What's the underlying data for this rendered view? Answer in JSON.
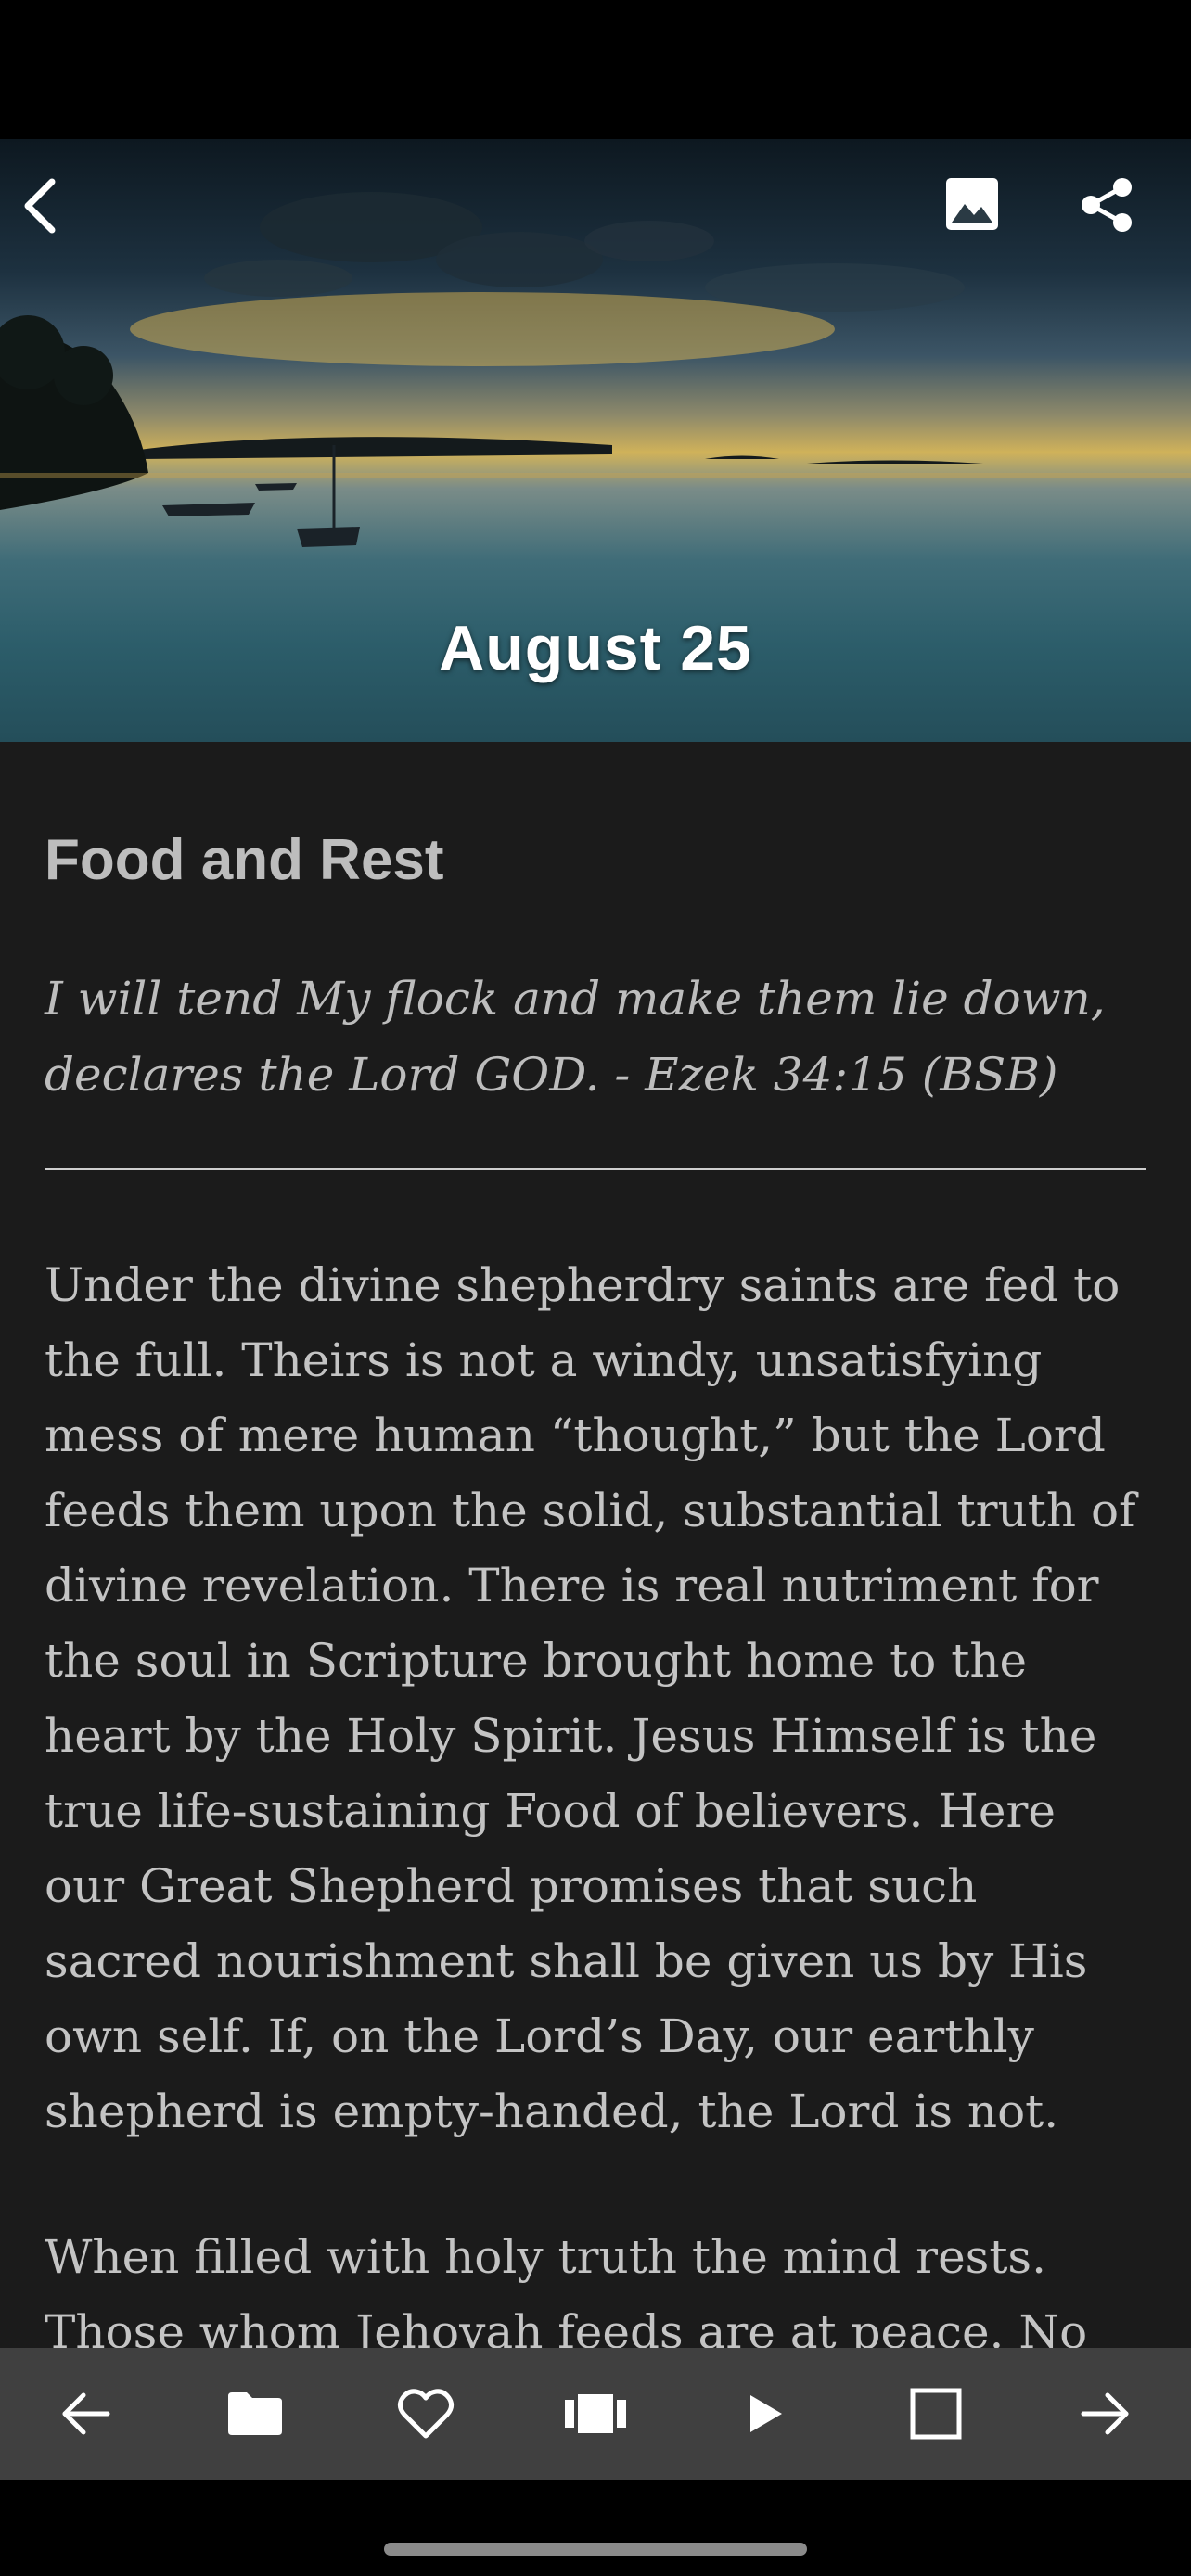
{
  "header": {
    "date": "August 25",
    "icons": [
      "back-arrow-icon",
      "image-icon",
      "share-icon"
    ]
  },
  "devotional": {
    "title": "Food and Rest",
    "verse": "I will tend My flock and make them lie down, declares the Lord GOD. - Ezek 34:15 (BSB)",
    "paragraphs": [
      "Under the divine shepherdry saints are fed to the full. Theirs is not a windy, unsatisfying mess of mere human “thought,” but the Lord feeds them upon the solid, substantial truth of divine revelation. There is real nutriment for the soul in Scripture brought home to the heart by the Holy Spirit. Jesus Himself is the true life-sustaining Food of believers. Here our Great Shepherd promises that such sacred nourishment shall be given us by His own self. If, on the Lord’s Day, our earthly shepherd is empty-handed, the Lord is not.",
      "When filled with holy truth the mind rests. Those whom Jehovah feeds are at peace. No"
    ]
  },
  "bottom_nav": {
    "icons": [
      "previous-arrow-icon",
      "folder-icon",
      "heart-icon",
      "carousel-icon",
      "play-icon",
      "square-icon",
      "next-arrow-icon"
    ]
  },
  "colors": {
    "background": "#1b1b1b",
    "bottom_bar": "#404040",
    "text": "#c4c4c4"
  }
}
